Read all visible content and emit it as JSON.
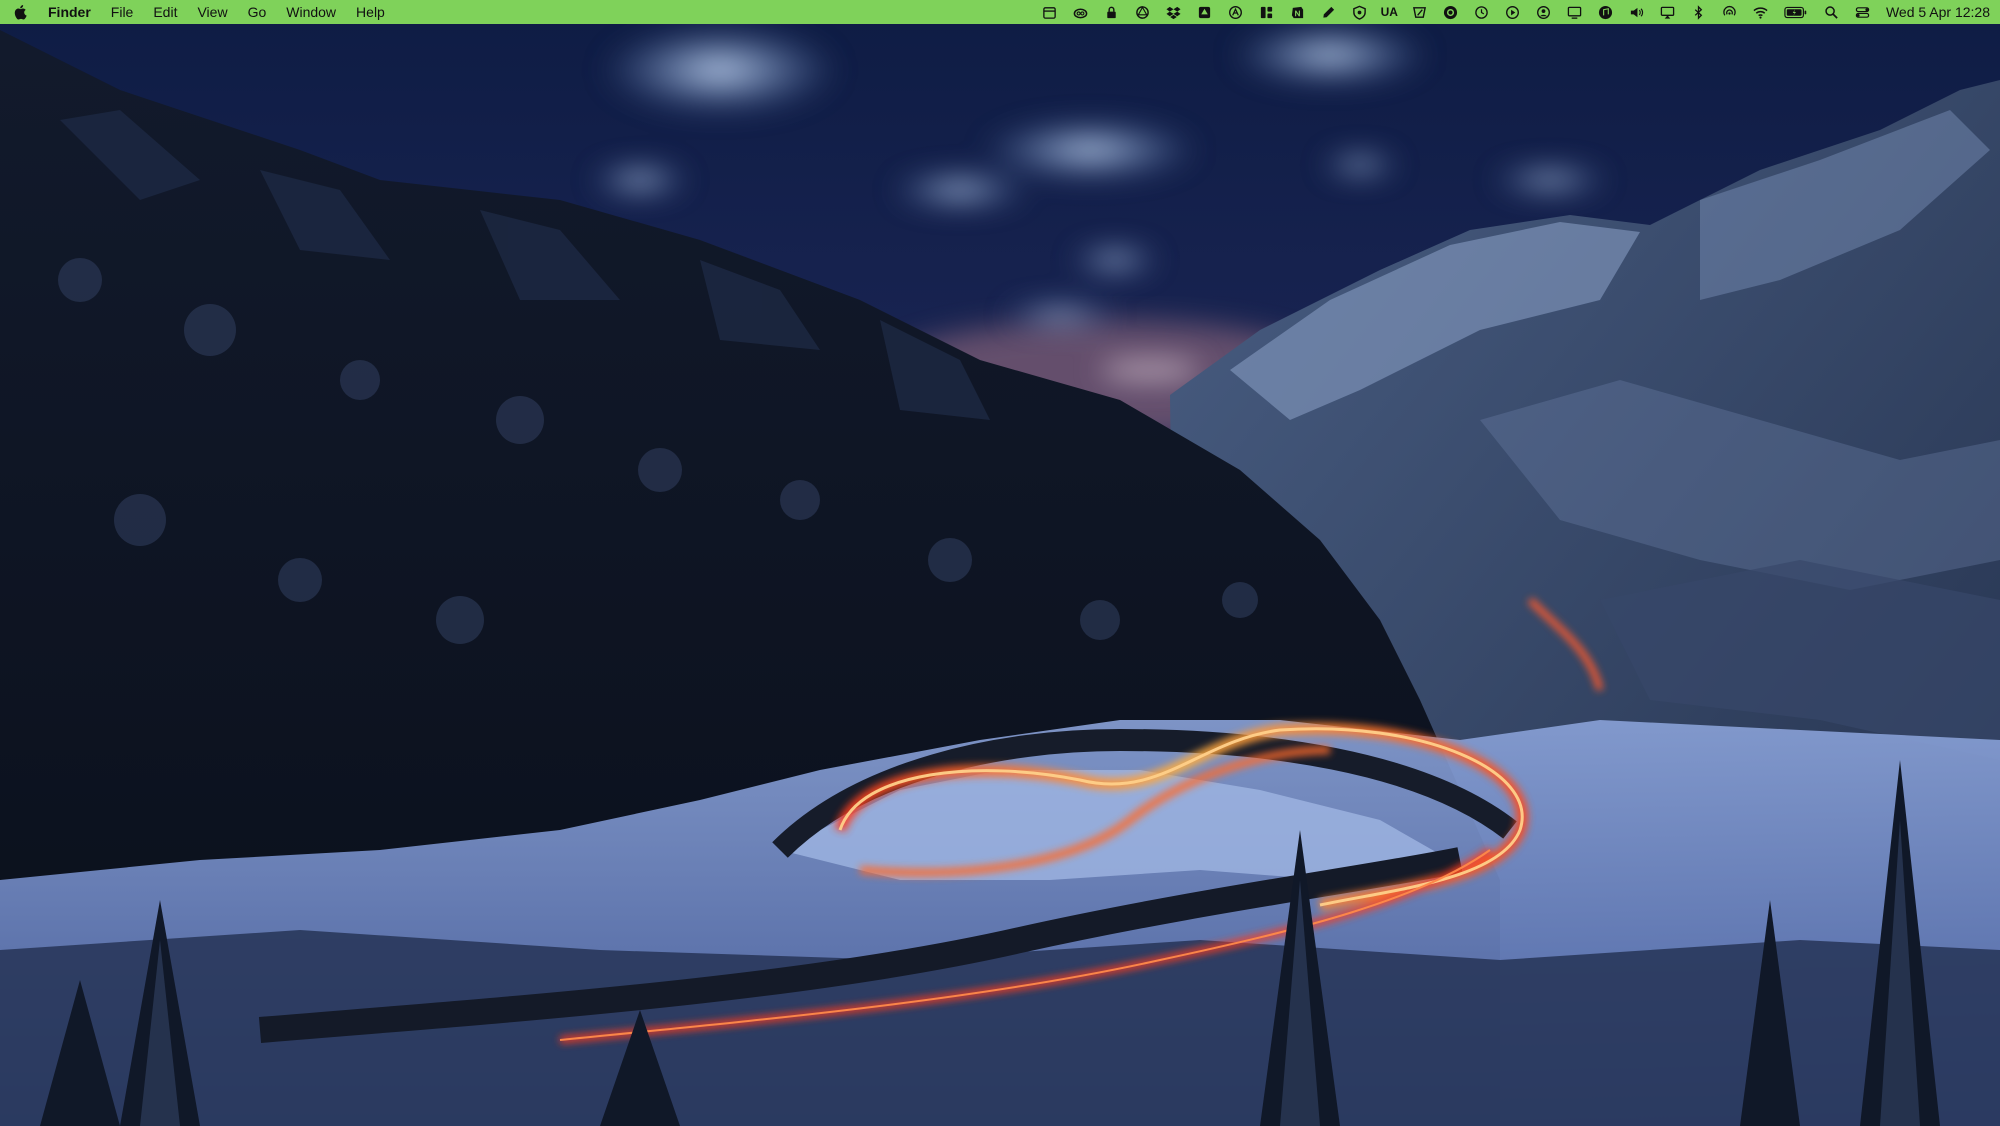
{
  "menubar": {
    "background": "#7fd25a",
    "apple_icon": "apple-logo-icon",
    "app_name": "Finder",
    "menus": [
      "File",
      "Edit",
      "View",
      "Go",
      "Window",
      "Help"
    ],
    "status_icons": [
      "calendar-icon",
      "creative-cloud-icon",
      "lock-icon",
      "openai-icon",
      "dropbox-icon",
      "google-drive-icon",
      "alfred-icon",
      "bartender-icon",
      "notion-icon",
      "pen-icon",
      "shield-icon"
    ],
    "language_indicator": "UA",
    "status_icons_after": [
      "sketch-icon",
      "screen-recorder-icon",
      "time-machine-icon",
      "play-icon",
      "user-icon",
      "display-icon",
      "music-icon",
      "volume-icon",
      "screen-mirroring-icon",
      "bluetooth-icon",
      "airdrop-icon",
      "wifi-icon",
      "battery-icon",
      "spotlight-search-icon",
      "control-center-icon"
    ],
    "clock": "Wed 5 Apr  12:28"
  },
  "wallpaper": {
    "icon": "wallpaper-winter-canyon-road-light-trails"
  }
}
